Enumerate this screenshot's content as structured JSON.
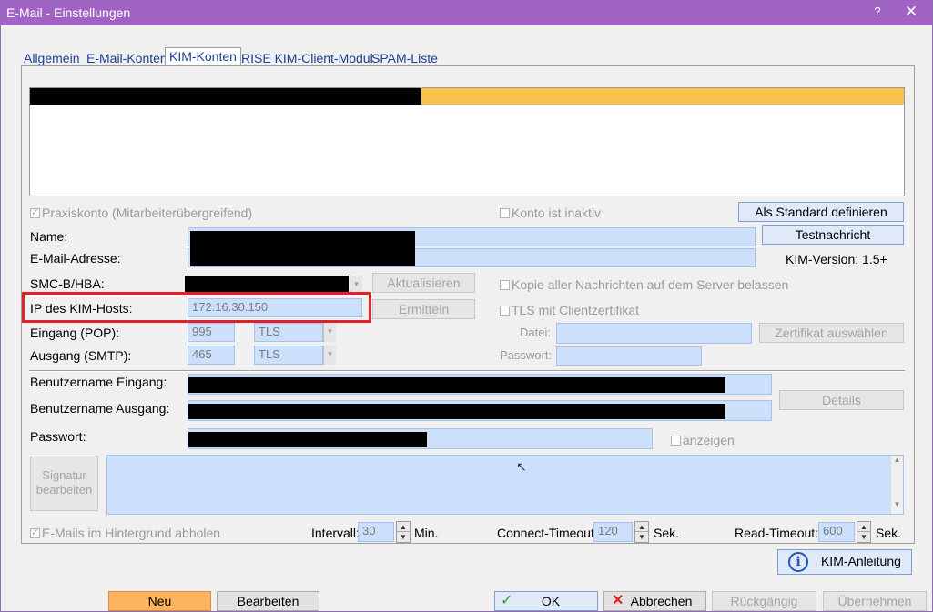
{
  "window": {
    "title": "E-Mail - Einstellungen",
    "help": "?",
    "close": "✕"
  },
  "tabs": [
    "Allgemein",
    "E-Mail-Konten",
    "KIM-Konten",
    "RISE KIM-Client-Modul",
    "SPAM-Liste"
  ],
  "form": {
    "praxiskonto": "Praxiskonto (Mitarbeiterübergreifend)",
    "konto_inaktiv": "Konto ist inaktiv",
    "als_standard": "Als Standard definieren",
    "testnachricht": "Testnachricht",
    "kim_version": "KIM-Version: 1.5+",
    "name_label": "Name:",
    "email_label": "E-Mail-Adresse:",
    "smc_label": "SMC-B/HBA:",
    "aktualisieren": "Aktualisieren",
    "kopie": "Kopie aller Nachrichten auf dem Server belassen",
    "ip_label": "IP des KIM-Hosts:",
    "ip_value": "172.16.30.150",
    "ermitteln": "Ermitteln",
    "tls_client": "TLS mit Clientzertifikat",
    "eingang_label": "Eingang (POP):",
    "eingang_port": "995",
    "eingang_sec": "TLS",
    "ausgang_label": "Ausgang (SMTP):",
    "ausgang_port": "465",
    "ausgang_sec": "TLS",
    "datei_label": "Datei:",
    "passwort2_label": "Passwort:",
    "zertifikat": "Zertifikat auswählen",
    "benutzer_eingang": "Benutzername Eingang:",
    "benutzer_ausgang": "Benutzername Ausgang:",
    "details": "Details",
    "passwort_label": "Passwort:",
    "anzeigen": "anzeigen",
    "signatur": "Signatur bearbeiten",
    "hintergrund": "E-Mails im Hintergrund abholen",
    "intervall_label": "Intervall:",
    "intervall_value": "30",
    "min": "Min.",
    "connect_label": "Connect-Timeout:",
    "connect_value": "120",
    "sek1": "Sek.",
    "read_label": "Read-Timeout:",
    "read_value": "600",
    "sek2": "Sek.",
    "kim_anleitung": "KIM-Anleitung"
  },
  "footer": {
    "neu": "Neu",
    "bearbeiten": "Bearbeiten",
    "ok": "OK",
    "abbrechen": "Abbrechen",
    "rueckgaengig": "Rückgängig",
    "uebernehmen": "Übernehmen"
  },
  "colors": {
    "titlebar": "#a062c3",
    "accent_yellow": "#f9c24d",
    "field": "#cce0fb",
    "highlight_red": "#e0202a",
    "neu_button": "#fbb35f"
  }
}
